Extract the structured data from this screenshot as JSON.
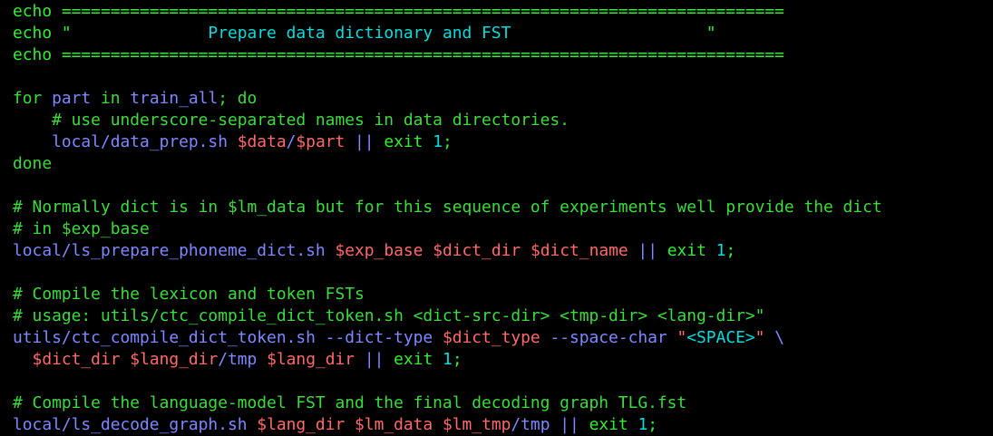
{
  "lines": [
    [
      {
        "t": "echo ==========================================================================",
        "c": "green"
      }
    ],
    [
      {
        "t": "echo \"",
        "c": "green"
      },
      {
        "t": "              Prepare data dictionary and FST                    ",
        "c": "string"
      },
      {
        "t": "\"",
        "c": "green"
      }
    ],
    [
      {
        "t": "echo ==========================================================================",
        "c": "green"
      }
    ],
    [],
    [
      {
        "t": "for ",
        "c": "keyword"
      },
      {
        "t": "part",
        "c": "path"
      },
      {
        "t": " in ",
        "c": "keyword"
      },
      {
        "t": "train_all",
        "c": "path"
      },
      {
        "t": "; do",
        "c": "keyword"
      }
    ],
    [
      {
        "t": "    # use underscore-separated names in data directories.",
        "c": "comment"
      }
    ],
    [
      {
        "t": "    ",
        "c": "text"
      },
      {
        "t": "local/data_prep.sh",
        "c": "path"
      },
      {
        "t": " ",
        "c": "text"
      },
      {
        "t": "$data",
        "c": "var"
      },
      {
        "t": "/",
        "c": "path"
      },
      {
        "t": "$part",
        "c": "var"
      },
      {
        "t": " || ",
        "c": "op"
      },
      {
        "t": "exit",
        "c": "kw2"
      },
      {
        "t": " ",
        "c": "text"
      },
      {
        "t": "1",
        "c": "number"
      },
      {
        "t": ";",
        "c": "kw2"
      }
    ],
    [
      {
        "t": "done",
        "c": "keyword"
      }
    ],
    [],
    [
      {
        "t": "# Normally dict is in $lm_data but for this sequence of experiments well provide the dict",
        "c": "comment"
      }
    ],
    [
      {
        "t": "# in $exp_base",
        "c": "comment"
      }
    ],
    [
      {
        "t": "local/ls_prepare_phoneme_dict.sh",
        "c": "path"
      },
      {
        "t": " ",
        "c": "text"
      },
      {
        "t": "$exp_base",
        "c": "var"
      },
      {
        "t": " ",
        "c": "text"
      },
      {
        "t": "$dict_dir",
        "c": "var"
      },
      {
        "t": " ",
        "c": "text"
      },
      {
        "t": "$dict_name",
        "c": "var"
      },
      {
        "t": " || ",
        "c": "op"
      },
      {
        "t": "exit",
        "c": "kw2"
      },
      {
        "t": " ",
        "c": "text"
      },
      {
        "t": "1",
        "c": "number"
      },
      {
        "t": ";",
        "c": "kw2"
      }
    ],
    [],
    [
      {
        "t": "# Compile the lexicon and token FSTs",
        "c": "comment"
      }
    ],
    [
      {
        "t": "# usage: utils/ctc_compile_dict_token.sh <dict-src-dir> <tmp-dir> <lang-dir>\"",
        "c": "comment"
      }
    ],
    [
      {
        "t": "utils/ctc_compile_dict_token.sh --dict-type ",
        "c": "path"
      },
      {
        "t": "$dict_type",
        "c": "var"
      },
      {
        "t": " --space-char ",
        "c": "path"
      },
      {
        "t": "\"",
        "c": "var"
      },
      {
        "t": "<SPACE>",
        "c": "string"
      },
      {
        "t": "\"",
        "c": "var"
      },
      {
        "t": " \\",
        "c": "path"
      }
    ],
    [
      {
        "t": "  ",
        "c": "text"
      },
      {
        "t": "$dict_dir",
        "c": "var"
      },
      {
        "t": " ",
        "c": "text"
      },
      {
        "t": "$lang_dir",
        "c": "var"
      },
      {
        "t": "/tmp",
        "c": "path"
      },
      {
        "t": " ",
        "c": "text"
      },
      {
        "t": "$lang_dir",
        "c": "var"
      },
      {
        "t": " || ",
        "c": "op"
      },
      {
        "t": "exit",
        "c": "kw2"
      },
      {
        "t": " ",
        "c": "text"
      },
      {
        "t": "1",
        "c": "number"
      },
      {
        "t": ";",
        "c": "kw2"
      }
    ],
    [],
    [
      {
        "t": "# Compile the language-model FST and the final decoding graph TLG.fst",
        "c": "comment"
      }
    ],
    [
      {
        "t": "local/ls_decode_graph.sh",
        "c": "path"
      },
      {
        "t": " ",
        "c": "text"
      },
      {
        "t": "$lang_dir",
        "c": "var"
      },
      {
        "t": " ",
        "c": "text"
      },
      {
        "t": "$lm_data",
        "c": "var"
      },
      {
        "t": " ",
        "c": "text"
      },
      {
        "t": "$lm_tmp",
        "c": "var"
      },
      {
        "t": "/tmp",
        "c": "path"
      },
      {
        "t": " || ",
        "c": "op"
      },
      {
        "t": "exit",
        "c": "kw2"
      },
      {
        "t": " ",
        "c": "text"
      },
      {
        "t": "1",
        "c": "number"
      },
      {
        "t": ";",
        "c": "kw2"
      }
    ]
  ]
}
